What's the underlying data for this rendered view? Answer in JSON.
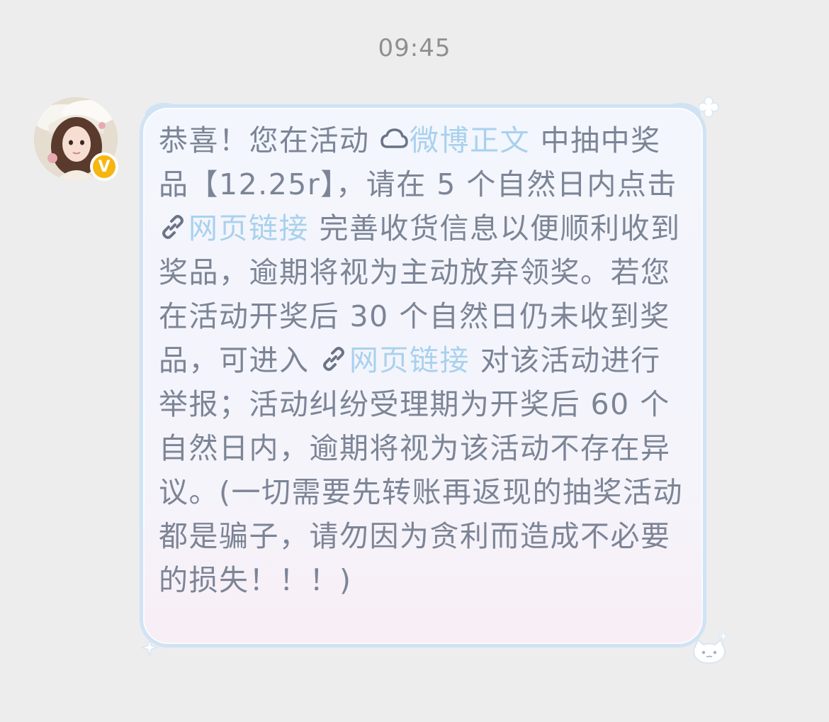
{
  "chat": {
    "timestamp": "09:45",
    "sender": {
      "verified_badge": "V"
    },
    "message": {
      "part1": "恭喜！您在活动 ",
      "link1_icon": "weibo-cloud-icon",
      "link1_text": "微博正文",
      "part2": " 中抽中奖品【12.25r】，请在 5 个自然日内点击 ",
      "link2_icon": "chain-link-icon",
      "link2_text": "网页链接",
      "part3": " 完善收货信息以便顺利收到奖品，逾期将视为主动放弃领奖。若您在活动开奖后 30 个自然日仍未收到奖品，可进入 ",
      "link3_icon": "chain-link-icon",
      "link3_text": "网页链接",
      "part4": " 对该活动进行举报；活动纠纷受理期为开奖后 60 个自然日内，逾期将视为该活动不存在异议。(一切需要先转账再返现的抽奖活动都是骗子，请勿因为贪利而造成不必要的损失！！！)"
    }
  },
  "colors": {
    "background": "#ededed",
    "text": "#7c8596",
    "link": "#a9d1ee",
    "bubble_border": "#cfe3f5",
    "badge": "#f6b612"
  }
}
